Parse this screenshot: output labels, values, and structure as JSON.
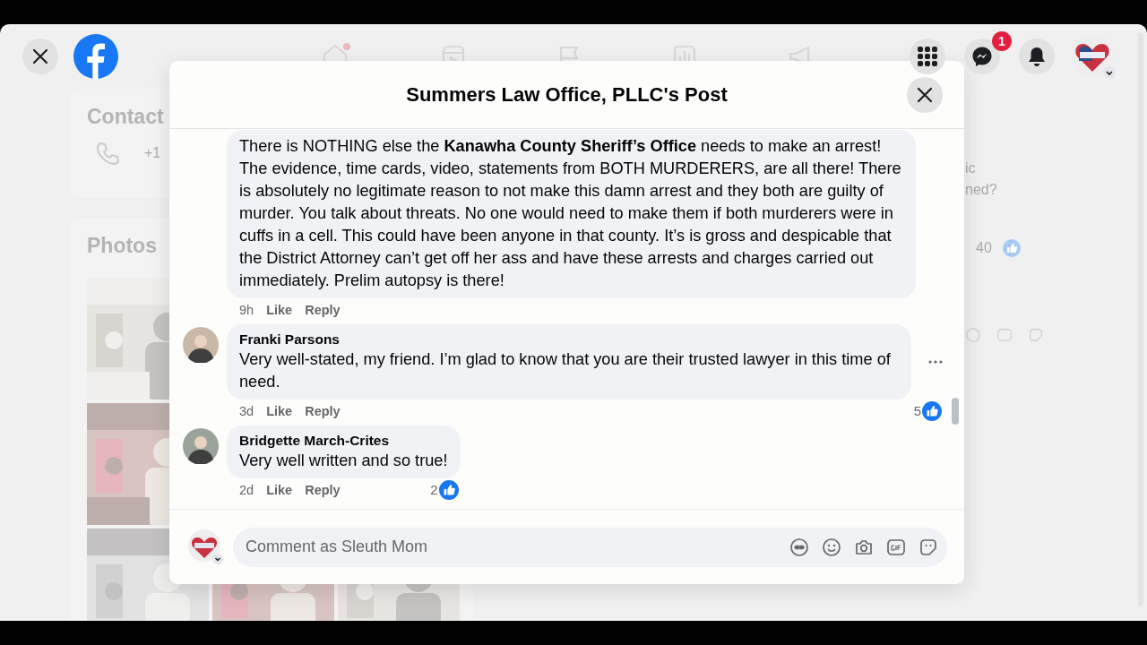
{
  "top_bar": {
    "messenger_badge": "1"
  },
  "background": {
    "contact_heading": "Contact",
    "phone_number": "+1",
    "photos_heading": "Photos",
    "side_lines": [
      "ic",
      "ned?"
    ],
    "side_reaction_count": "40"
  },
  "post_dialog": {
    "title": "Summers Law Office, PLLC's Post",
    "comments": [
      {
        "text": "There is NOTHING else the **Kanawha County Sheriff’s Office** needs to make an arrest! The evidence, time cards, video, statements from BOTH MURDERERS, are all there! There is absolutely no legitimate reason to not make this damn arrest and they both are guilty of murder. You talk about threats. No one would need to make them if both murderers were in cuffs in a cell. This could have been anyone in that county. It’s is gross and despicable that the District Attorney can’t get off her ass and have these arrests and charges carried out immediately. Prelim autopsy is there!",
        "time": "9h",
        "actions": [
          "Like",
          "Reply"
        ],
        "options_visible": false
      },
      {
        "author": "Franki Parsons",
        "text": "Very well-stated, my friend. I’m glad to know that you are their trusted lawyer in this time of need.",
        "time": "3d",
        "actions": [
          "Like",
          "Reply"
        ],
        "reaction_count": "5",
        "options_visible": true
      },
      {
        "author": "Bridgette March-Crites",
        "text": "Very well written and so true!",
        "time": "2d",
        "actions": [
          "Like",
          "Reply"
        ],
        "reaction_count": "2",
        "options_visible": false
      }
    ],
    "composer": {
      "placeholder": "Comment as Sleuth Mom"
    }
  }
}
